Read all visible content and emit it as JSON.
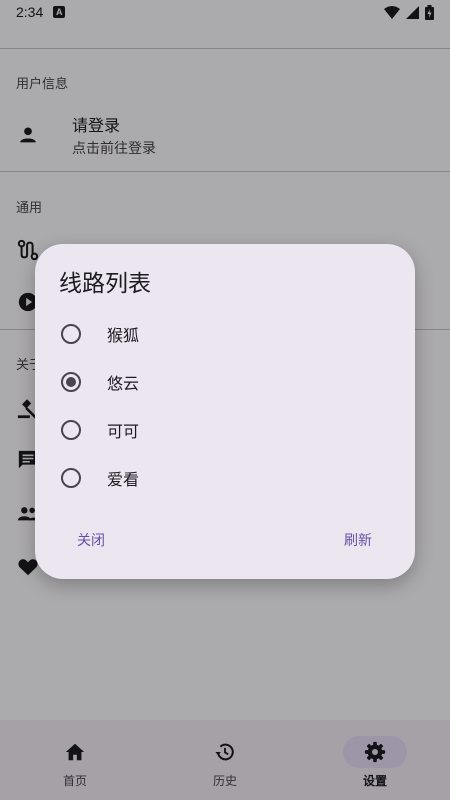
{
  "status_bar": {
    "time": "2:34",
    "badge": "A"
  },
  "settings": {
    "section_user": "用户信息",
    "login_title": "请登录",
    "login_sub": "点击前往登录",
    "section_general": "通用",
    "section_about": "关于"
  },
  "dialog": {
    "title": "线路列表",
    "options": [
      {
        "label": "猴狐",
        "selected": false
      },
      {
        "label": "悠云",
        "selected": true
      },
      {
        "label": "可可",
        "selected": false
      },
      {
        "label": "爱看",
        "selected": false
      }
    ],
    "close_label": "关闭",
    "refresh_label": "刷新"
  },
  "bottom_nav": {
    "items": [
      {
        "label": "首页",
        "icon": "home-icon",
        "active": false
      },
      {
        "label": "历史",
        "icon": "history-icon",
        "active": false
      },
      {
        "label": "设置",
        "icon": "settings-icon",
        "active": true
      }
    ]
  },
  "colors": {
    "accent": "#6750a4",
    "dialog_bg": "#ece6f0",
    "nav_bg": "#f3edf7"
  }
}
